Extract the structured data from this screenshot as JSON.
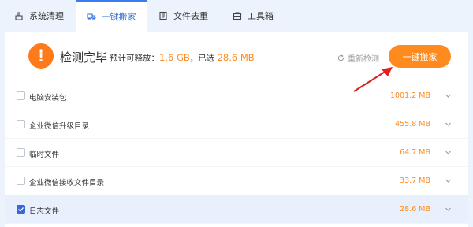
{
  "tabs": [
    {
      "label": "系统清理",
      "icon": "broom-icon",
      "active": false
    },
    {
      "label": "一键搬家",
      "icon": "truck-icon",
      "active": true
    },
    {
      "label": "文件去重",
      "icon": "duplicate-file-icon",
      "active": false
    },
    {
      "label": "工具箱",
      "icon": "toolbox-icon",
      "active": false
    }
  ],
  "header": {
    "status_icon": "warning-icon",
    "title": "检测完毕",
    "summary_prefix": "预计可释放：",
    "releasable": "1.6 GB",
    "summary_mid": "，已选",
    "selected_size": "28.6 MB",
    "recheck_label": "重新检测",
    "action_label": "一键搬家"
  },
  "rows": [
    {
      "name": "电脑安装包",
      "size": "1001.2 MB",
      "checked": false
    },
    {
      "name": "企业微信升级目录",
      "size": "455.8 MB",
      "checked": false
    },
    {
      "name": "临时文件",
      "size": "64.7 MB",
      "checked": false
    },
    {
      "name": "企业微信接收文件目录",
      "size": "33.7 MB",
      "checked": false
    },
    {
      "name": "日志文件",
      "size": "28.6 MB",
      "checked": true
    }
  ],
  "colors": {
    "accent": "#ff8a1e",
    "primary_blue": "#3a66d8",
    "arrow_red": "#e01f1f"
  }
}
